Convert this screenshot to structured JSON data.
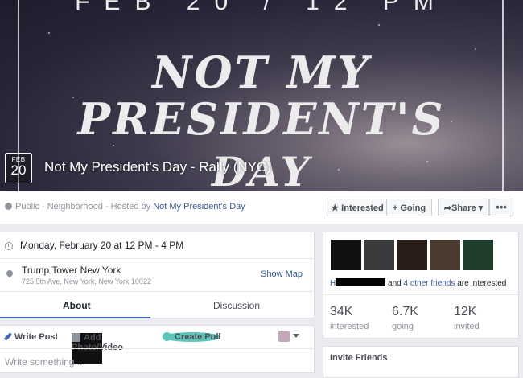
{
  "cover": {
    "banner_text": "FEB 20 / 12 PM",
    "line1": "NOT MY",
    "line2": "PRESIDENT'S",
    "line3": "DAY"
  },
  "event": {
    "date_month": "FEB",
    "date_day": "20",
    "title": "Not My President's Day - Rally (NYC)"
  },
  "infobar": {
    "privacy": "Public · Neighborhood · Hosted by ",
    "host": "Not My President's Day",
    "buttons": {
      "interested": "★ Interested",
      "going": "+ Going",
      "share": "➦Share ▾",
      "more": "•••"
    }
  },
  "details": {
    "datetime": "Monday, February 20 at 12 PM - 4 PM",
    "location_name": "Trump Tower New York",
    "location_address": "725 5th Ave, New York, New York 10022",
    "show_map": "Show Map",
    "tabs": [
      "About",
      "Discussion"
    ]
  },
  "composer": {
    "write_post": "Write Post",
    "add_photo": "Add Photo/Video",
    "create_poll": "Create Poll",
    "placeholder": "Write something..."
  },
  "guests": {
    "prefix": "H",
    "and": " and ",
    "others": "4 other friends",
    "suffix": " are interested",
    "stats": [
      {
        "value": "34K",
        "label": "interested"
      },
      {
        "value": "6.7K",
        "label": "going"
      },
      {
        "value": "12K",
        "label": "invited"
      }
    ]
  },
  "invite": {
    "title": "Invite Friends"
  }
}
